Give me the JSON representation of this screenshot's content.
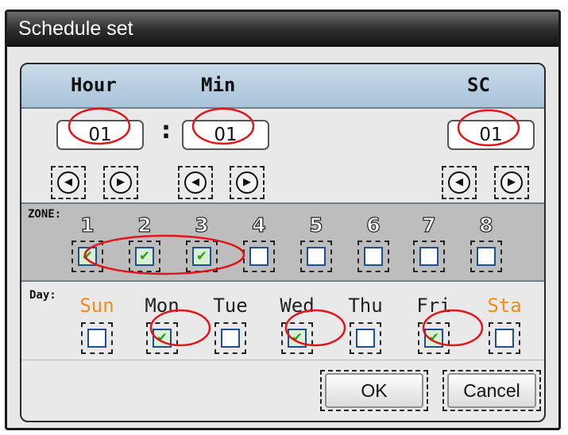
{
  "window": {
    "title": "Schedule set"
  },
  "header": {
    "hour_label": "Hour",
    "min_label": "Min",
    "sc_label": "SC"
  },
  "time": {
    "hour": "01",
    "minute": "01",
    "sc": "01",
    "separator": ":"
  },
  "arrows": {
    "left_glyph": "◀",
    "right_glyph": "▶"
  },
  "zone": {
    "label": "ZONE:",
    "items": [
      {
        "number": "1",
        "checked": true
      },
      {
        "number": "2",
        "checked": true
      },
      {
        "number": "3",
        "checked": true
      },
      {
        "number": "4",
        "checked": false
      },
      {
        "number": "5",
        "checked": false
      },
      {
        "number": "6",
        "checked": false
      },
      {
        "number": "7",
        "checked": false
      },
      {
        "number": "8",
        "checked": false
      }
    ]
  },
  "day": {
    "label": "Day:",
    "items": [
      {
        "name": "Sun",
        "checked": false,
        "weekend": true
      },
      {
        "name": "Mon",
        "checked": true,
        "weekend": false
      },
      {
        "name": "Tue",
        "checked": false,
        "weekend": false
      },
      {
        "name": "Wed",
        "checked": true,
        "weekend": false
      },
      {
        "name": "Thu",
        "checked": false,
        "weekend": false
      },
      {
        "name": "Fri",
        "checked": true,
        "weekend": false
      },
      {
        "name": "Sta",
        "checked": false,
        "weekend": true
      }
    ]
  },
  "buttons": {
    "ok_label": "OK",
    "cancel_label": "Cancel"
  },
  "colors": {
    "weekend": "#f08c1e",
    "annotation": "#e0161b",
    "check": "#2d9c22",
    "header": "#b7cde0"
  }
}
